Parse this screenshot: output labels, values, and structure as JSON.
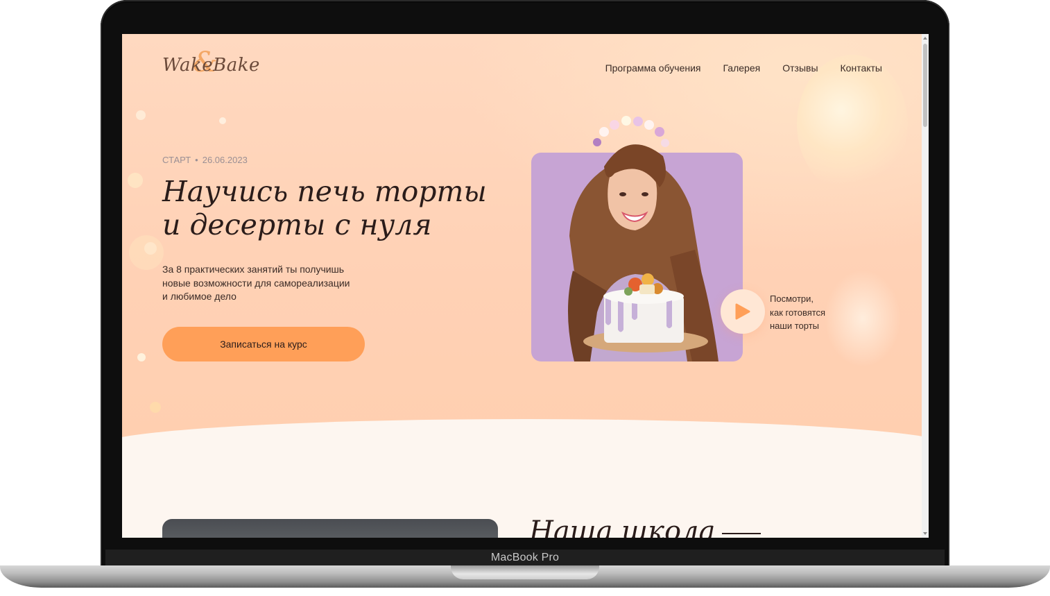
{
  "device": {
    "brand_label": "MacBook Pro"
  },
  "site": {
    "logo": {
      "word1": "Wake",
      "amp": "&",
      "word2": "Bake"
    },
    "nav": [
      {
        "label": "Программа обучения"
      },
      {
        "label": "Галерея"
      },
      {
        "label": "Отзывы"
      },
      {
        "label": "Контакты"
      }
    ],
    "hero": {
      "start_label": "СТАРТ",
      "start_separator": "•",
      "start_date": "26.06.2023",
      "headline_line1": "Научись печь торты",
      "headline_line2": "и десерты с нуля",
      "subtext_line1": "За 8 практических занятий ты получишь",
      "subtext_line2": "новые возможности для самореализации",
      "subtext_line3": "и любимое дело",
      "cta_label": "Записаться на курс",
      "video_caption_line1": "Посмотри,",
      "video_caption_line2": "как готовятся",
      "video_caption_line3": "наши торты",
      "play_icon": "play-icon"
    },
    "next_section": {
      "title": "Наша школа"
    }
  },
  "colors": {
    "hero_bg": "#ffd4b8",
    "accent_orange": "#ff9f58",
    "card_purple": "#c7a4d4",
    "text_dark": "#2a1c1a"
  }
}
